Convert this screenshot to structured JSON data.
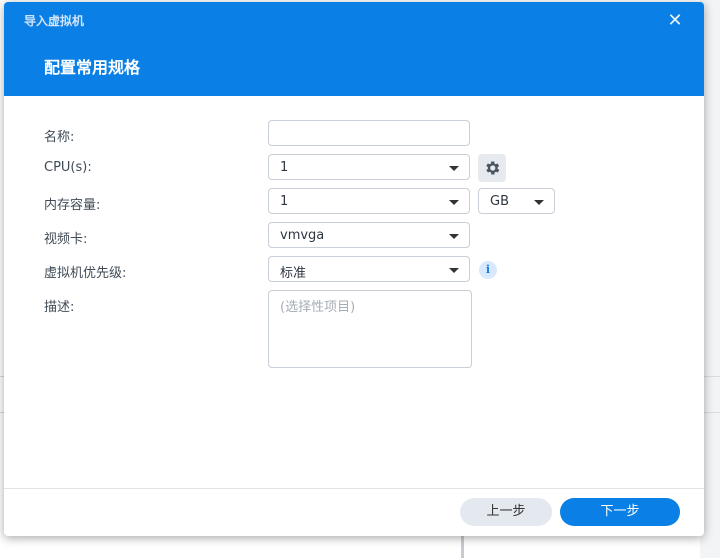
{
  "window": {
    "title": "导入虚拟机",
    "close_icon": "close-icon"
  },
  "page": {
    "title": "配置常用规格"
  },
  "form": {
    "name": {
      "label": "名称:",
      "value": ""
    },
    "cpu": {
      "label": "CPU(s):",
      "value": "1",
      "settings_icon": "gear-icon"
    },
    "memory": {
      "label": "内存容量:",
      "value": "1",
      "unit": "GB"
    },
    "video_card": {
      "label": "视频卡:",
      "value": "vmvga"
    },
    "priority": {
      "label": "虚拟机优先级:",
      "value": "标准",
      "info_icon": "info-icon"
    },
    "description": {
      "label": "描述:",
      "placeholder": "(选择性项目)"
    }
  },
  "footer": {
    "prev_label": "上一步",
    "next_label": "下一步"
  },
  "colors": {
    "accent": "#0a7fe6",
    "secondary_button": "#e4e9f0"
  }
}
